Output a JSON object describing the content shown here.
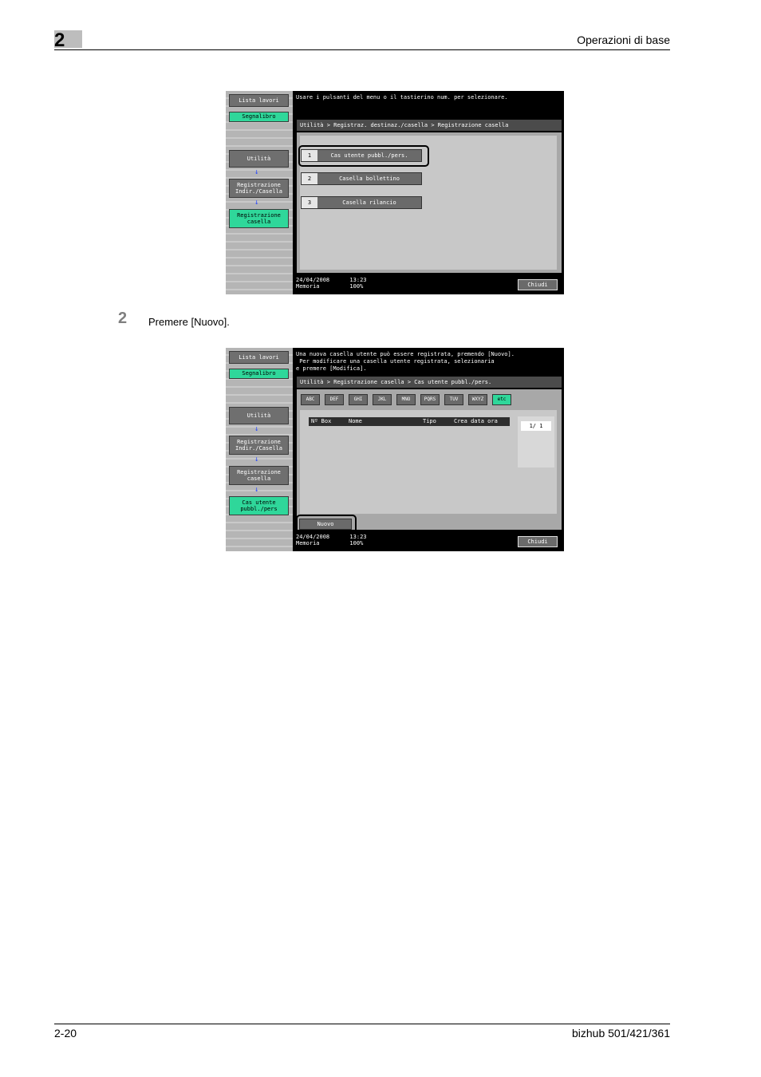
{
  "header": {
    "chapter": "2",
    "title": "Operazioni di base"
  },
  "footer": {
    "page": "2-20",
    "product": "bizhub 501/421/361"
  },
  "step": {
    "number": "2",
    "text": "Premere [Nuovo]."
  },
  "screen1": {
    "side": {
      "lista_lavori": "Lista lavori",
      "segnalibro": "Segnalibro",
      "utilita": "Utilità",
      "reg_indir_l1": "Registrazione",
      "reg_indir_l2": "Indir./Casella",
      "reg_casella_l1": "Registrazione",
      "reg_casella_l2": "casella"
    },
    "message": "Usare i pulsanti del menu o il tastierino num. per selezionare.",
    "breadcrumb": "Utilità > Registraz. destinaz./casella > Registrazione casella",
    "options": [
      {
        "num": "1",
        "label": "Cas utente pubbl./pers."
      },
      {
        "num": "2",
        "label": "Casella bollettino"
      },
      {
        "num": "3",
        "label": "Casella rilancio"
      }
    ],
    "status_l1": "24/04/2008      13:23",
    "status_l2": "Memoria         100%",
    "close": "Chiudi"
  },
  "screen2": {
    "side": {
      "lista_lavori": "Lista lavori",
      "segnalibro": "Segnalibro",
      "utilita": "Utilità",
      "reg_indir_l1": "Registrazione",
      "reg_indir_l2": "Indir./Casella",
      "reg_casella_l1": "Registrazione",
      "reg_casella_l2": "casella",
      "cas_utente_l1": "Cas utente",
      "cas_utente_l2": "pubbl./pers"
    },
    "message_l1": "Una nuova casella utente può essere registrata, premendo [Nuovo].",
    "message_l2": " Per modificare una casella utente registrata, selezionaria",
    "message_l3": "e premere [Modifica].",
    "breadcrumb": "Utilità > Registrazione casella > Cas utente pubbl./pers.",
    "tabs": [
      "ABC",
      "DEF",
      "GHI",
      "JKL",
      "MNO",
      "PQRS",
      "TUV",
      "WXYZ",
      "etc"
    ],
    "columns": [
      "Nº Box",
      "Nome",
      "Tipo",
      "Crea data ora"
    ],
    "page": "1/  1",
    "new_button": "Nuovo",
    "status_l1": "24/04/2008      13:23",
    "status_l2": "Memoria         100%",
    "close": "Chiudi"
  }
}
